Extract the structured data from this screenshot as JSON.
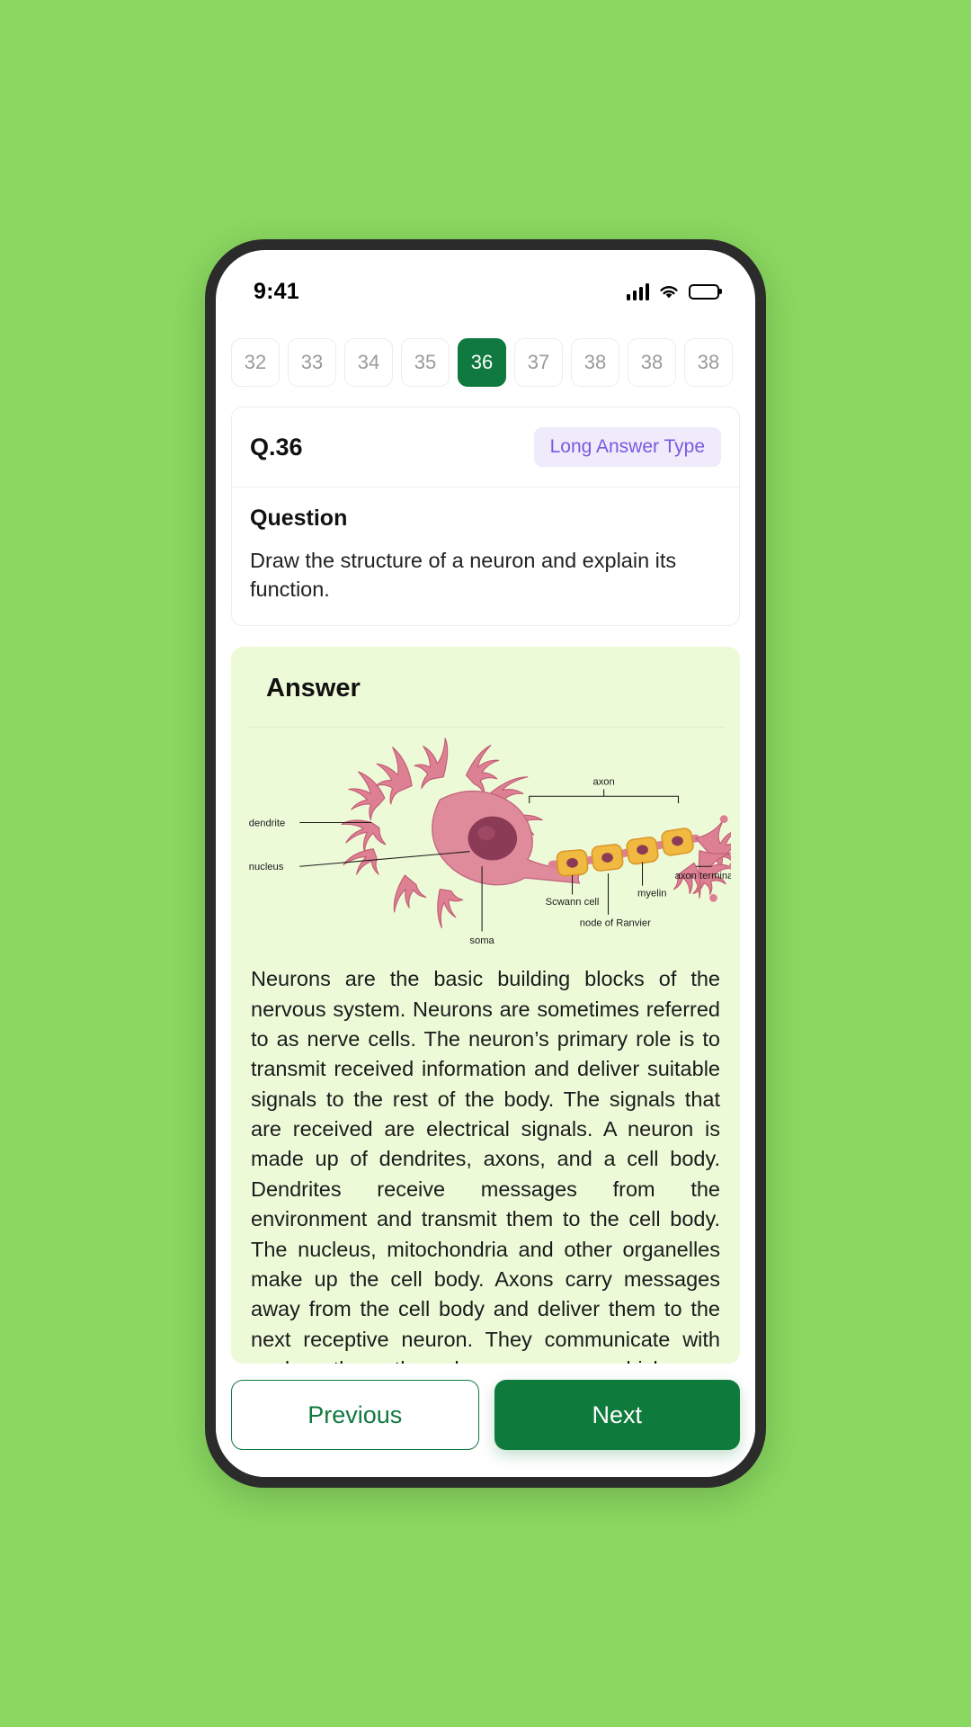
{
  "theme": {
    "page_background": "#8AD860",
    "accent_green": "#10793F",
    "answer_card_background": "#EDFAD8",
    "badge_background": "#EFEBFB",
    "badge_text_color": "#7B58E0"
  },
  "status_bar": {
    "time": "9:41",
    "icons": [
      "cellular-signal-icon",
      "wifi-icon",
      "battery-icon"
    ]
  },
  "pager": {
    "items": [
      {
        "label": "32",
        "active": false
      },
      {
        "label": "33",
        "active": false
      },
      {
        "label": "34",
        "active": false
      },
      {
        "label": "35",
        "active": false
      },
      {
        "label": "36",
        "active": true
      },
      {
        "label": "37",
        "active": false
      },
      {
        "label": "38",
        "active": false
      },
      {
        "label": "38",
        "active": false
      },
      {
        "label": "38",
        "active": false
      }
    ]
  },
  "question_card": {
    "number": "Q.36",
    "badge": "Long Answer Type",
    "section_label": "Question",
    "text": "Draw the structure of a neuron and explain its function."
  },
  "answer_card": {
    "title": "Answer",
    "diagram": {
      "name": "neuron-structure-diagram",
      "labels": {
        "dendrite": "dendrite",
        "nucleus": "nucleus",
        "axon": "axon",
        "schwann_cell": "Scwann cell",
        "node_of_ranvier": "node of Ranvier",
        "myelin": "myelin",
        "axon_terminal": "axon terminal",
        "soma": "soma"
      }
    },
    "text": "Neurons are the basic building blocks of the nervous system. Neurons are sometimes referred to as nerve cells. The neuron’s primary role is to transmit received information and deliver suitable signals to the rest of the body. The signals that are received are electrical signals. A neuron is made up of dendrites, axons, and a cell body. Dendrites receive messages from the environment and transmit them to the cell body. The nucleus, mitochondria and other organelles make up the cell body. Axons carry messages away from the cell body and deliver them to the next receptive neuron. They communicate with each other through synapses, which are specialized junctions where signals are transmitted from one neuron to another. Neurotransmitters are released at synapses to facilitate this communication."
  },
  "footer": {
    "previous_label": "Previous",
    "next_label": "Next"
  }
}
